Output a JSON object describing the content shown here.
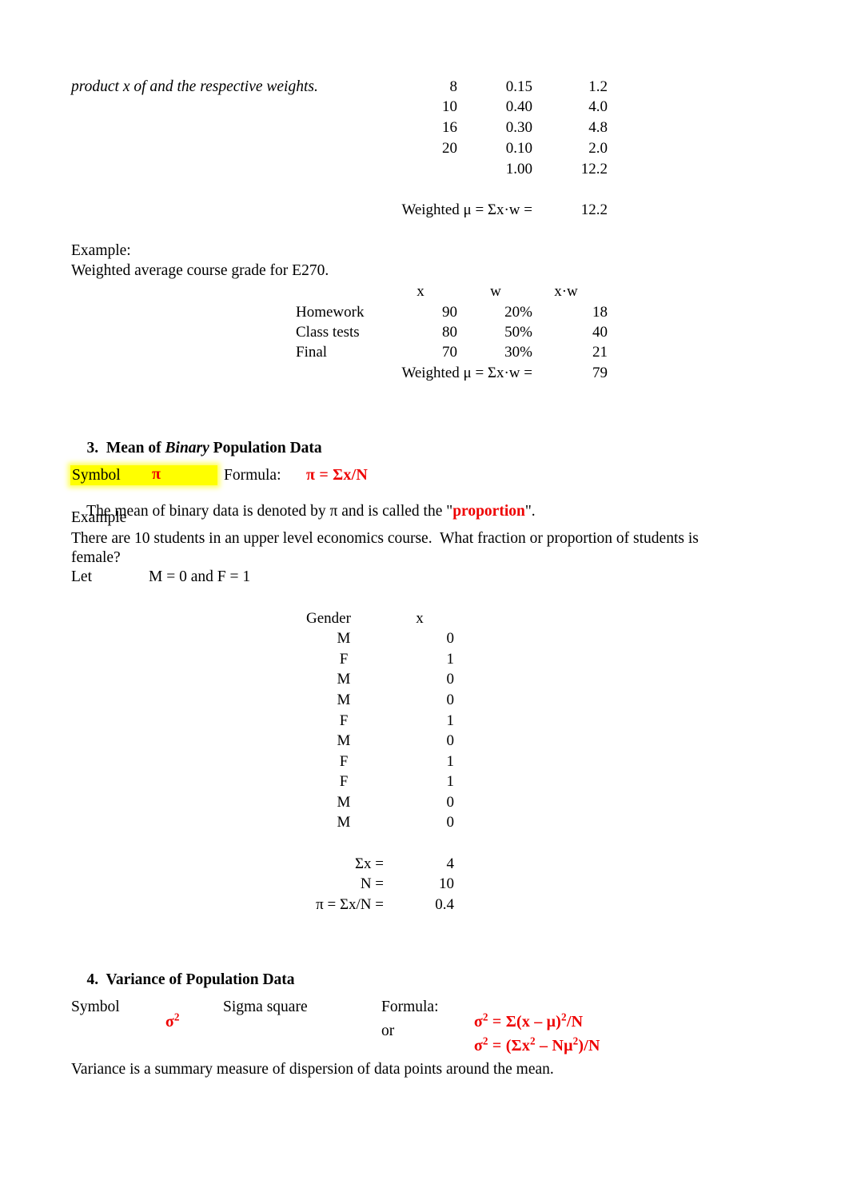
{
  "document": {
    "page_background": "#ffffff",
    "accent_red": "#EE0000",
    "highlight_yellow": "#FFFF00"
  },
  "intro": {
    "continuation_line": "product x of and the respective weights."
  },
  "weighted_table_1": {
    "rows": [
      {
        "x": "8",
        "w": "0.15",
        "xw": "1.2"
      },
      {
        "x": "10",
        "w": "0.40",
        "xw": "4.0"
      },
      {
        "x": "16",
        "w": "0.30",
        "xw": "4.8"
      },
      {
        "x": "20",
        "w": "0.10",
        "xw": "2.0"
      }
    ],
    "totals": {
      "x": "",
      "w": "1.00",
      "xw": "12.2"
    },
    "result_label": "Weighted μ = Σx·w =",
    "result_value": "12.2"
  },
  "example_grade": {
    "example_label": "Example:",
    "description": "Weighted average course grade for E270.",
    "headers": {
      "item": "",
      "x": "x",
      "w": "w",
      "xw": "x·w"
    },
    "rows": [
      {
        "item": "Homework",
        "x": "90",
        "w": "20%",
        "xw": "18"
      },
      {
        "item": "Class tests",
        "x": "80",
        "w": "50%",
        "xw": "40"
      },
      {
        "item": "Final",
        "x": "70",
        "w": "30%",
        "xw": "21"
      }
    ],
    "result_label": "Weighted μ = Σx·w =",
    "result_value": "79"
  },
  "section3": {
    "number": "3.",
    "title_pre": "Mean of ",
    "title_italic": "Binary",
    "title_post": " Population Data",
    "symbol_label": "Symbol",
    "symbol_value": "π",
    "formula_label": "Formula:",
    "formula_value": "π = Σx/N",
    "definition_pre": "The mean of binary data is denoted by π and is called the \"",
    "definition_highlight": "proportion",
    "definition_post": "\".",
    "example_label": "Example",
    "example_line1": "There are 10 students in an upper level economics course.  What fraction or proportion of students is",
    "example_line2": "female?",
    "let_label": "Let",
    "let_value": "M = 0 and F = 1"
  },
  "binary_table": {
    "headers": {
      "gender": "Gender",
      "x": "x"
    },
    "rows": [
      {
        "gender": "M",
        "x": "0"
      },
      {
        "gender": "F",
        "x": "1"
      },
      {
        "gender": "M",
        "x": "0"
      },
      {
        "gender": "M",
        "x": "0"
      },
      {
        "gender": "F",
        "x": "1"
      },
      {
        "gender": "M",
        "x": "0"
      },
      {
        "gender": "F",
        "x": "1"
      },
      {
        "gender": "F",
        "x": "1"
      },
      {
        "gender": "M",
        "x": "0"
      },
      {
        "gender": "M",
        "x": "0"
      }
    ],
    "summary": [
      {
        "label": "Σx =",
        "value": "4"
      },
      {
        "label": "N =",
        "value": "10"
      },
      {
        "label": "π = Σx/N =",
        "value": "0.4"
      }
    ]
  },
  "section4": {
    "number": "4.",
    "title": "Variance of Population Data",
    "symbol_label": "Symbol",
    "symbol_base": "σ",
    "symbol_exp": "2",
    "symbol_name": "Sigma square",
    "formula_label": "Formula:",
    "formula_or_label": "or",
    "formula1": {
      "lhs_base": "σ",
      "lhs_exp": "2",
      "mid": " = Σ(x – μ)",
      "mid_exp": "2",
      "tail": "/N"
    },
    "formula2": {
      "lhs_base": "σ",
      "lhs_exp": "2",
      "mid": " = (Σx",
      "mid_exp": "2",
      "mid2": " – Nμ",
      "mid2_exp": "2",
      "tail": ")/N"
    },
    "closing_text": "Variance is a summary measure of dispersion of data points around the mean."
  }
}
